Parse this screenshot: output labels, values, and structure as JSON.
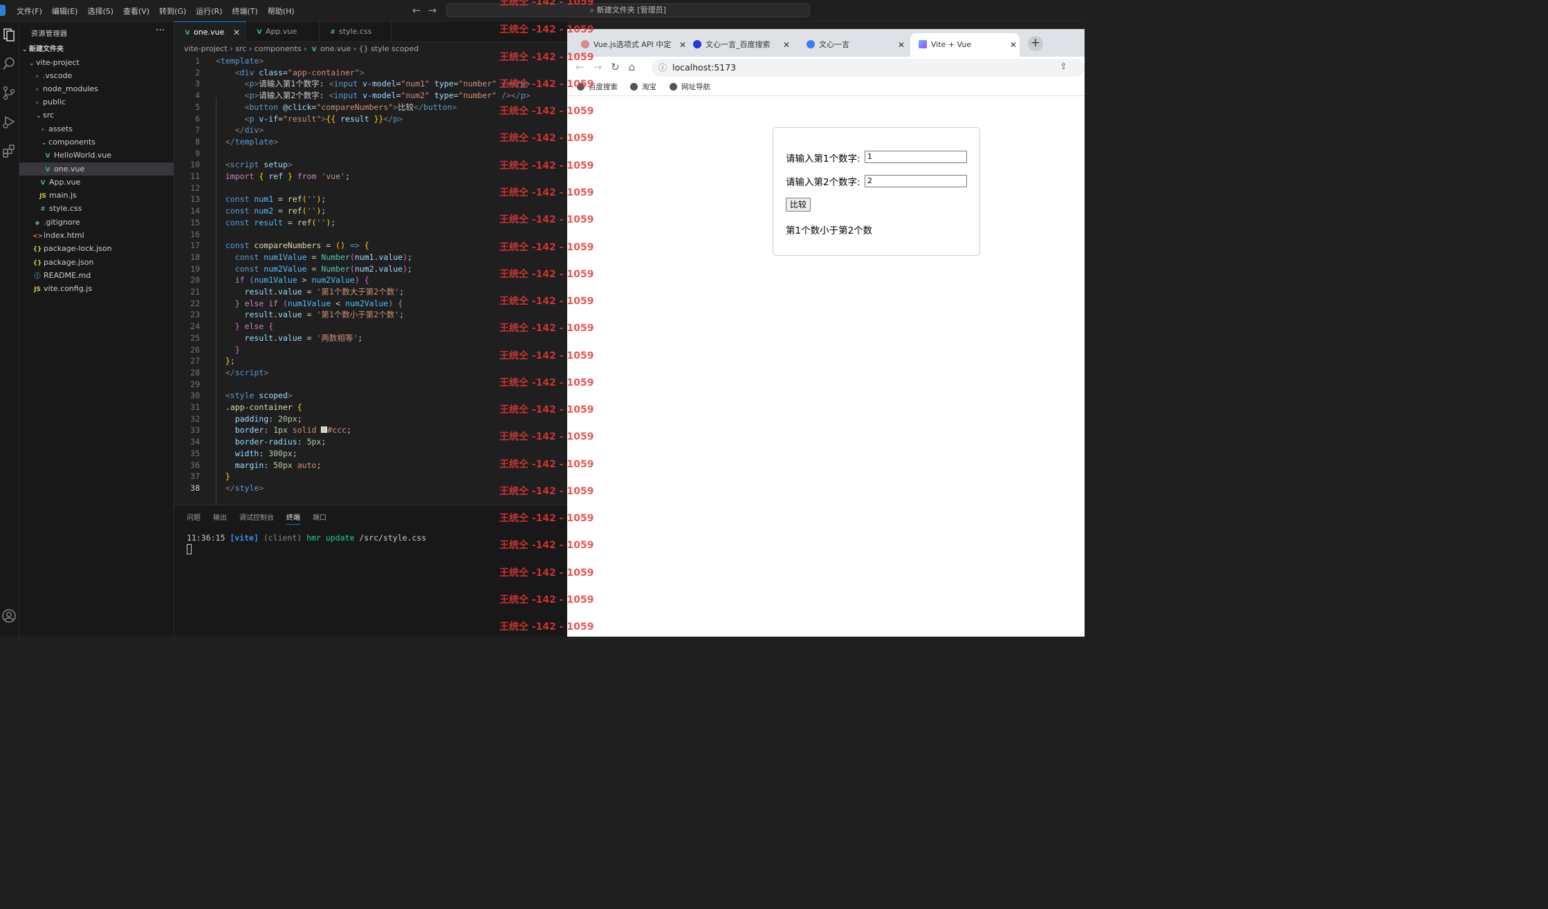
{
  "titlebar": {
    "menus": [
      "文件(F)",
      "编辑(E)",
      "选择(S)",
      "查看(V)",
      "转到(G)",
      "运行(R)",
      "终端(T)",
      "帮助(H)"
    ],
    "search": "新建文件夹 [管理员]"
  },
  "sidebar": {
    "title": "资源管理器",
    "items": [
      {
        "label": "新建文件夹",
        "icon": "chevron-down",
        "indent": 0,
        "bold": true
      },
      {
        "label": "vite-project",
        "icon": "chevron-down",
        "indent": 1
      },
      {
        "label": ".vscode",
        "icon": "chevron-right",
        "indent": 2
      },
      {
        "label": "node_modules",
        "icon": "chevron-right",
        "indent": 2
      },
      {
        "label": "public",
        "icon": "chevron-right",
        "indent": 2
      },
      {
        "label": "src",
        "icon": "chevron-down",
        "indent": 2
      },
      {
        "label": "assets",
        "icon": "chevron-right",
        "indent": 3
      },
      {
        "label": "components",
        "icon": "chevron-down",
        "indent": 3
      },
      {
        "label": "HelloWorld.vue",
        "icon": "vue",
        "indent": 4
      },
      {
        "label": "one.vue",
        "icon": "vue",
        "indent": 4,
        "selected": true
      },
      {
        "label": "App.vue",
        "icon": "vue",
        "indent": 3
      },
      {
        "label": "main.js",
        "icon": "js",
        "indent": 3
      },
      {
        "label": "style.css",
        "icon": "css",
        "indent": 3
      },
      {
        "label": ".gitignore",
        "icon": "git",
        "indent": 2
      },
      {
        "label": "index.html",
        "icon": "html",
        "indent": 2
      },
      {
        "label": "package-lock.json",
        "icon": "json",
        "indent": 2
      },
      {
        "label": "package.json",
        "icon": "json",
        "indent": 2
      },
      {
        "label": "README.md",
        "icon": "info",
        "indent": 2
      },
      {
        "label": "vite.config.js",
        "icon": "js",
        "indent": 2
      }
    ]
  },
  "editor": {
    "tabs": [
      "one.vue",
      "App.vue",
      "style.css"
    ],
    "breadcrumb": [
      "vite-project",
      "src",
      "components",
      "one.vue",
      "{} style scoped"
    ],
    "current_line": 38
  },
  "panel": {
    "tabs": [
      "问题",
      "输出",
      "调试控制台",
      "终端",
      "端口"
    ],
    "active_tab": "终端",
    "terminal_time": "11:36:15",
    "terminal_tag": "[vite]",
    "terminal_client": "(client)",
    "terminal_msg": "hmr update",
    "terminal_path": "/src/style.css"
  },
  "watermark": "王统仝 -142 - 1059",
  "browser": {
    "tabs": [
      "Vue.js选项式 API 中定",
      "文心一言_百度搜索",
      "文心一言",
      "Vite + Vue"
    ],
    "url": "localhost:5173",
    "bookmarks": [
      "百度搜索",
      "淘宝",
      "网址导航"
    ],
    "app": {
      "label1": "请输入第1个数字:",
      "value1": "1",
      "label2": "请输入第2个数字:",
      "value2": "2",
      "button": "比较",
      "result": "第1个数小于第2个数"
    }
  }
}
